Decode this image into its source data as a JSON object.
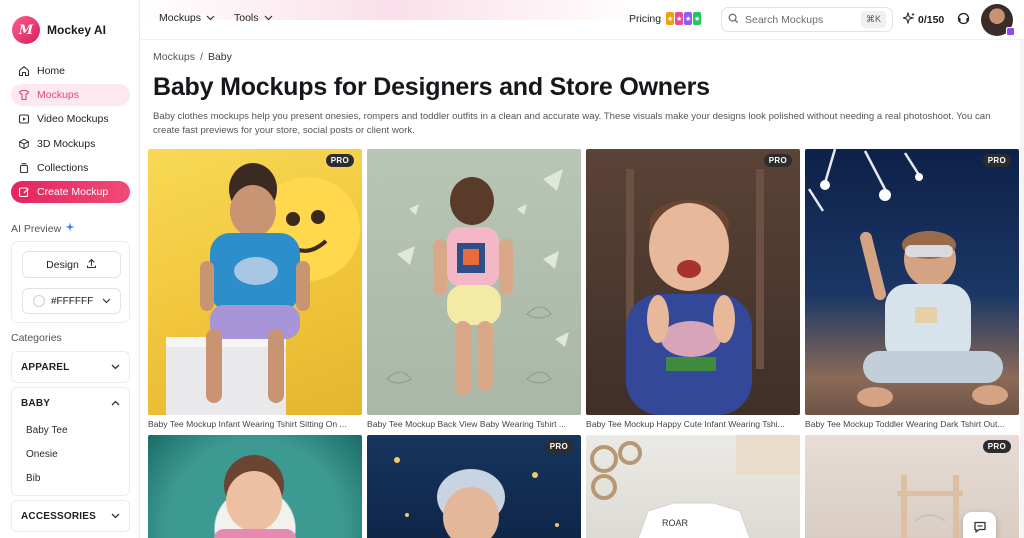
{
  "brand": {
    "name": "Mockey AI",
    "logo_text": "M"
  },
  "sidebar": {
    "nav": [
      {
        "label": "Home",
        "icon": "home-icon",
        "active": false
      },
      {
        "label": "Mockups",
        "icon": "mockups-icon",
        "active": true
      },
      {
        "label": "Video Mockups",
        "icon": "video-icon",
        "active": false
      },
      {
        "label": "3D Mockups",
        "icon": "cube-icon",
        "active": false
      },
      {
        "label": "Collections",
        "icon": "collections-icon",
        "active": false
      }
    ],
    "cta_label": "Create Mockup",
    "ai_preview_label": "AI Preview",
    "design_label": "Design",
    "color_value": "#FFFFFF",
    "categories_label": "Categories",
    "categories": [
      {
        "label": "APPAREL",
        "expanded": false
      },
      {
        "label": "BABY",
        "expanded": true,
        "items": [
          "Baby Tee",
          "Onesie",
          "Bib"
        ]
      },
      {
        "label": "ACCESSORIES",
        "expanded": false
      }
    ]
  },
  "topbar": {
    "mockups_label": "Mockups",
    "tools_label": "Tools",
    "pricing_label": "Pricing",
    "search_placeholder": "Search Mockups",
    "shortcut": "⌘K",
    "credits": "0/150"
  },
  "breadcrumb": {
    "root": "Mockups",
    "sep": "/",
    "current": "Baby"
  },
  "page": {
    "title": "Baby Mockups for Designers and Store Owners",
    "description": "Baby clothes mockups help you present onesies, rompers and toddler outfits in a clean and accurate way. These visuals make your designs look polished without needing a real photoshoot. You can create fast previews for your store, social posts or client work."
  },
  "cards": [
    {
      "caption": "Baby Tee Mockup Infant Wearing Tshirt Sitting On ...",
      "pro": true
    },
    {
      "caption": "Baby Tee Mockup Back View Baby Wearing Tshirt ...",
      "pro": false
    },
    {
      "caption": "Baby Tee Mockup Happy Cute Infant Wearing Tshi...",
      "pro": true
    },
    {
      "caption": "Baby Tee Mockup Toddler Wearing Dark Tshirt Out...",
      "pro": true
    },
    {
      "caption": "",
      "pro": false
    },
    {
      "caption": "",
      "pro": true
    },
    {
      "caption": "",
      "pro": false
    },
    {
      "caption": "",
      "pro": true
    }
  ],
  "pro_label": "PRO",
  "shirt_print": "ROAR",
  "colors": {
    "accent": "#e6245e",
    "active_bg": "#fde8ef"
  }
}
